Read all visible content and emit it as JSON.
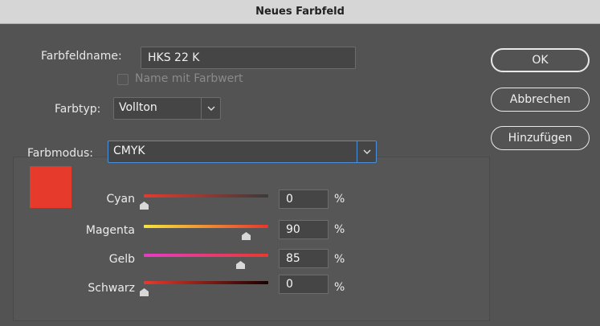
{
  "window": {
    "title": "Neues Farbfeld"
  },
  "fields": {
    "name_label": "Farbfeldname:",
    "name_value": "HKS 22 K",
    "name_with_value_label": "Name mit Farbwert",
    "type_label": "Farbtyp:",
    "type_value": "Vollton",
    "mode_label": "Farbmodus:",
    "mode_value": "CMYK"
  },
  "buttons": {
    "ok": "OK",
    "cancel": "Abbrechen",
    "add": "Hinzufügen"
  },
  "swatch": {
    "color": "#e63a2d"
  },
  "sliders": [
    {
      "label": "Cyan",
      "value": "0",
      "unit": "%",
      "level": 0.0
    },
    {
      "label": "Magenta",
      "value": "90",
      "unit": "%",
      "level": 0.9
    },
    {
      "label": "Gelb",
      "value": "85",
      "unit": "%",
      "level": 0.85
    },
    {
      "label": "Schwarz",
      "value": "0",
      "unit": "%",
      "level": 0.0
    }
  ],
  "colors": {
    "focus": "#4a90d9",
    "background": "#535353"
  }
}
